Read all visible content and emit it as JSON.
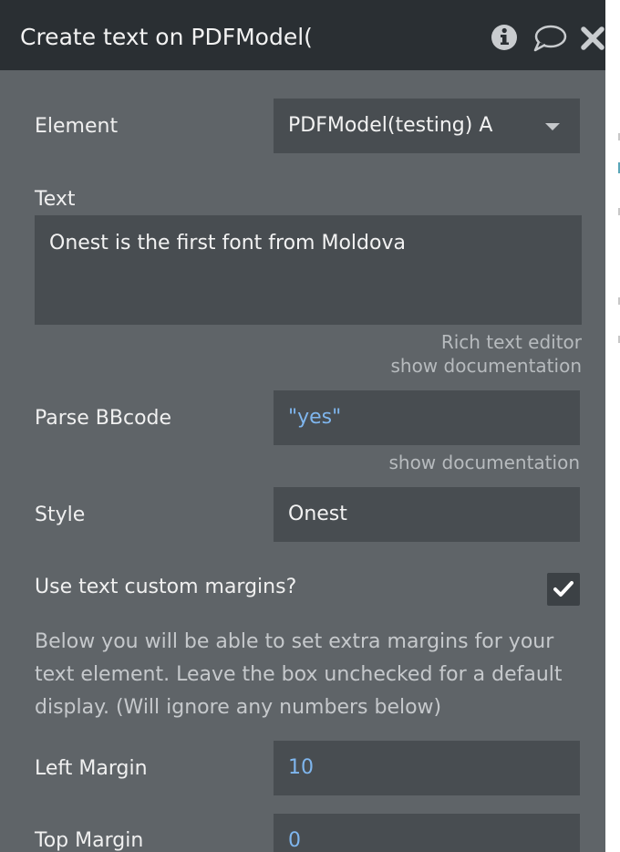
{
  "window": {
    "title": "Create text on PDFModel(",
    "icons": [
      "info-icon",
      "comment-icon",
      "close-icon"
    ]
  },
  "fields": {
    "element": {
      "label": "Element",
      "value": "PDFModel(testing) A"
    },
    "text": {
      "label": "Text",
      "value": "Onest is the first font from Moldova",
      "helper_editor": "Rich text editor",
      "helper_docs": "show documentation"
    },
    "parse_bbcode": {
      "label": "Parse BBcode",
      "value": "\"yes\"",
      "helper_docs": "show documentation"
    },
    "style": {
      "label": "Style",
      "value": "Onest"
    },
    "custom_margins": {
      "label": "Use text custom margins?",
      "checked": true,
      "description": "Below you will be able to set extra margins for your text element. Leave the box unchecked for a default display. (Will ignore any numbers below)"
    },
    "left_margin": {
      "label": "Left Margin",
      "value": "10"
    },
    "top_margin": {
      "label": "Top Margin",
      "value": "0"
    }
  },
  "colors": {
    "panel_bg": "#5f6468",
    "titlebar_bg": "#2a2f33",
    "field_bg": "#484d51",
    "dynamic_value": "#7fb6ee"
  }
}
